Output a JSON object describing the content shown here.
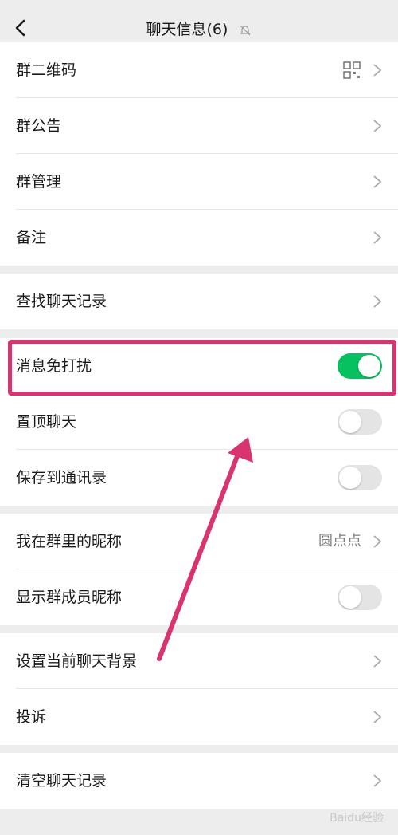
{
  "header": {
    "title": "聊天信息(6)",
    "back_icon": "chevron-left-icon",
    "mute_icon": "bell-off-icon"
  },
  "group1": [
    {
      "label": "群二维码",
      "trailing": "qr-code-icon"
    },
    {
      "label": "群公告"
    },
    {
      "label": "群管理"
    },
    {
      "label": "备注"
    }
  ],
  "group2": [
    {
      "label": "查找聊天记录"
    }
  ],
  "group3": [
    {
      "label": "消息免打扰",
      "toggle": true
    },
    {
      "label": "置顶聊天",
      "toggle": false
    },
    {
      "label": "保存到通讯录",
      "toggle": false
    }
  ],
  "group4": [
    {
      "label": "我在群里的昵称",
      "value": "圆点点"
    },
    {
      "label": "显示群成员昵称",
      "toggle": false
    }
  ],
  "group5": [
    {
      "label": "设置当前聊天背景"
    },
    {
      "label": "投诉"
    }
  ],
  "group6": [
    {
      "label": "清空聊天记录"
    }
  ],
  "watermark": "Baidu经验",
  "colors": {
    "toggle_on": "#07c160",
    "highlight": "#d8346f",
    "background": "#ededed"
  }
}
